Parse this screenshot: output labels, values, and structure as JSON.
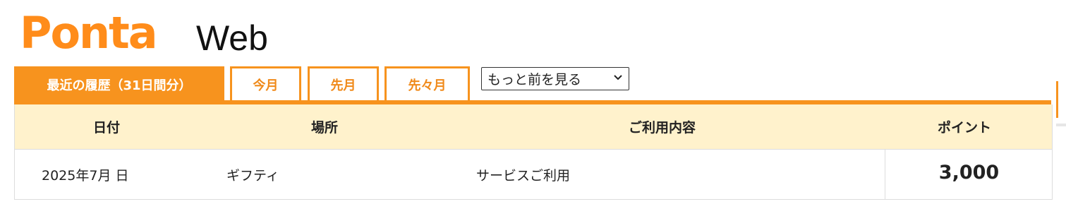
{
  "logo": {
    "brand": "Ponta",
    "suffix": "Web"
  },
  "tabs": {
    "recent": "最近の履歴（31日間分）",
    "this_month": "今月",
    "last_month": "先月",
    "two_months_ago": "先々月"
  },
  "period_select": {
    "selected": "もっと前を見る"
  },
  "table": {
    "headers": {
      "date": "日付",
      "place": "場所",
      "detail": "ご利用内容",
      "points": "ポイント"
    },
    "rows": [
      {
        "date": "2025年7月  日",
        "place": "ギフティ",
        "detail": "サービスご利用",
        "points": "3,000"
      }
    ]
  },
  "colors": {
    "accent": "#f7931e",
    "header_bg": "#fff2cc"
  }
}
